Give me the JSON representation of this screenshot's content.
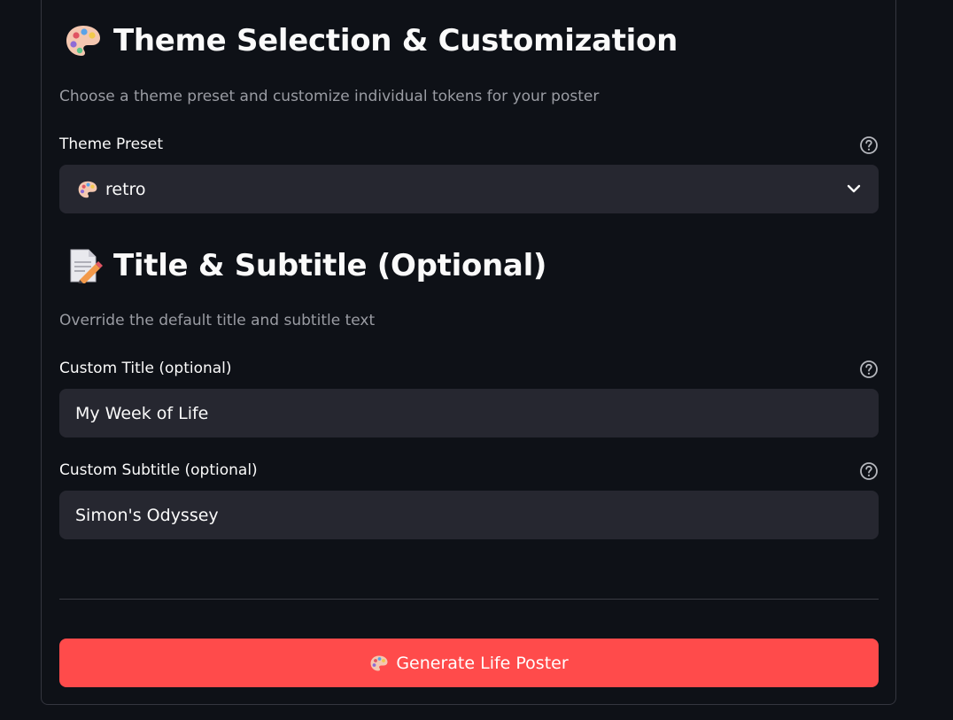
{
  "theme_section": {
    "icon": "palette-icon",
    "title": "Theme Selection & Customization",
    "caption": "Choose a theme preset and customize individual tokens for your poster",
    "preset_label": "Theme Preset",
    "preset_value": "retro",
    "preset_value_icon": "palette-icon"
  },
  "title_section": {
    "icon": "memo-icon",
    "title": "Title & Subtitle (Optional)",
    "caption": "Override the default title and subtitle text",
    "custom_title_label": "Custom Title (optional)",
    "custom_title_value": "My Week of Life",
    "custom_subtitle_label": "Custom Subtitle (optional)",
    "custom_subtitle_value": "Simon's Odyssey"
  },
  "generate_button": {
    "icon": "palette-icon",
    "label": "Generate Life Poster"
  },
  "colors": {
    "background": "#0e1117",
    "input_background": "#262730",
    "primary_button": "#ff4b4b",
    "caption_text": "#9a9ca3"
  }
}
